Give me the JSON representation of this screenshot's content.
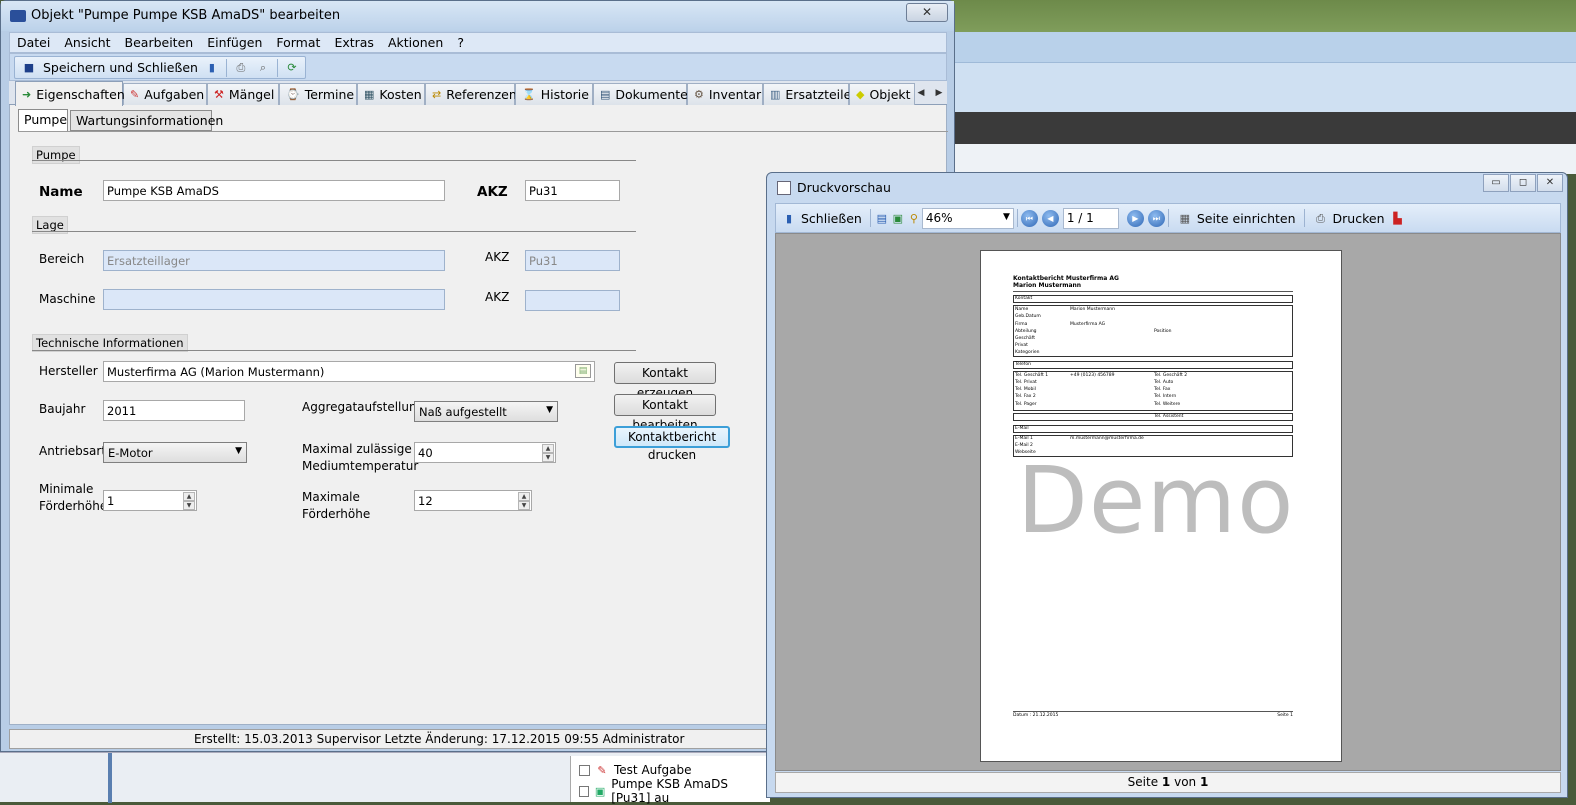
{
  "main_window": {
    "title": "Objekt \"Pumpe Pumpe KSB AmaDS\" bearbeiten",
    "close_glyph": "✕",
    "menu": [
      "Datei",
      "Ansicht",
      "Bearbeiten",
      "Einfügen",
      "Format",
      "Extras",
      "Aktionen",
      "?"
    ],
    "toolbar": {
      "save_close_label": "Speichern und Schließen"
    },
    "tabs": [
      {
        "label": "Eigenschaften",
        "icon": "eigenschaften-icon"
      },
      {
        "label": "Aufgaben",
        "icon": "aufgaben-icon"
      },
      {
        "label": "Mängel",
        "icon": "maengel-icon"
      },
      {
        "label": "Termine",
        "icon": "termine-icon"
      },
      {
        "label": "Kosten",
        "icon": "kosten-icon"
      },
      {
        "label": "Referenzen",
        "icon": "referenzen-icon"
      },
      {
        "label": "Historie",
        "icon": "historie-icon"
      },
      {
        "label": "Dokumente",
        "icon": "dokumente-icon"
      },
      {
        "label": "Inventar",
        "icon": "inventar-icon"
      },
      {
        "label": "Ersatzteile",
        "icon": "ersatzteile-icon"
      },
      {
        "label": "Objekt",
        "icon": "objekt-icon"
      }
    ],
    "subtabs": [
      "Pumpe",
      "Wartungsinformationen"
    ],
    "sections": {
      "pumpe": "Pumpe",
      "lage": "Lage",
      "technik": "Technische Informationen"
    },
    "form": {
      "name_label": "Name",
      "name_value": "Pumpe KSB AmaDS",
      "akz_label_big": "AKZ",
      "akz_value": "Pu31",
      "bereich_label": "Bereich",
      "bereich_value": "Ersatzteillager",
      "akz_label": "AKZ",
      "akz_bereich_value": "Pu31",
      "maschine_label": "Maschine",
      "maschine_value": "",
      "akz_maschine_value": "",
      "hersteller_label": "Hersteller",
      "hersteller_value": "Musterfirma AG  (Marion Mustermann)",
      "baujahr_label": "Baujahr",
      "baujahr_value": "2011",
      "aggregat_label": "Aggregataufstellung",
      "aggregat_value": "Naß aufgestellt",
      "antrieb_label": "Antriebsart",
      "antrieb_value": "E-Motor",
      "maxtemp_label_1": "Maximal zulässige",
      "maxtemp_label_2": "Mediumtemperatur",
      "maxtemp_value": "40",
      "minfh_label_1": "Minimale",
      "minfh_label_2": "Förderhöhe",
      "minfh_value": "1",
      "maxfh_label_1": "Maximale",
      "maxfh_label_2": "Förderhöhe",
      "maxfh_value": "12"
    },
    "buttons": {
      "kontakt_erzeugen": "Kontakt erzeugen",
      "kontakt_bearbeiten": "Kontakt bearbeiten",
      "kontaktbericht_drucken": "Kontaktbericht drucken"
    },
    "status": "Erstellt: 15.03.2013 Supervisor  Letzte Änderung: 17.12.2015 09:55 Administrator"
  },
  "background_list": [
    {
      "label": "Test Aufgabe"
    },
    {
      "label": "Pumpe KSB AmaDS [Pu31] au"
    }
  ],
  "preview_window": {
    "title": "Druckvorschau",
    "window_buttons": [
      "▭",
      "◻",
      "✕"
    ],
    "toolbar": {
      "close_label": "Schließen",
      "zoom": "46%",
      "page": "1 / 1",
      "setup_label": "Seite einrichten",
      "print_label": "Drucken"
    },
    "page_preview": {
      "heading_1": "Kontaktbericht Musterfirma AG",
      "heading_2": "Marion Mustermann",
      "section_kontakt": "Kontakt",
      "kontakt_rows": [
        {
          "k": "Name",
          "v": "Marion Mustermann"
        },
        {
          "k": "Geb.Datum",
          "v": ""
        },
        {
          "k": "Firma",
          "v": "Musterfirma AG"
        },
        {
          "k": "Abteilung",
          "v": ""
        },
        {
          "k": "Geschäft",
          "v": ""
        },
        {
          "k": "Privat",
          "v": ""
        },
        {
          "k": "Kategorien",
          "v": ""
        }
      ],
      "position_label": "Position",
      "section_telefon": "Telefon",
      "telefon_rows": [
        {
          "k": "Tel. Geschäft 1",
          "v": "+49 (0123) 456789",
          "k2": "Tel. Geschäft 2"
        },
        {
          "k": "Tel. Privat",
          "v": "",
          "k2": "Tel. Auto"
        },
        {
          "k": "Tel. Mobil",
          "v": "",
          "k2": "Tel. Fax"
        },
        {
          "k": "Tel. Fax 2",
          "v": "",
          "k2": "Tel. Intern"
        },
        {
          "k": "Tel. Pager",
          "v": "",
          "k2": "Tel. Weitere"
        }
      ],
      "assistent_label": "Tel. Assistent",
      "section_email": "E-Mail",
      "email_rows": [
        {
          "k": "E-Mail 1",
          "v": "m.mustermann@musterfirma.de"
        },
        {
          "k": "E-Mail 2",
          "v": ""
        },
        {
          "k": "Webseite",
          "v": ""
        }
      ],
      "watermark": "Demo",
      "footer_left": "Datum : 21.12.2015",
      "footer_right": "Seite 1"
    },
    "status_prefix": "Seite ",
    "status_page": "1",
    "status_mid": " von ",
    "status_total": "1"
  },
  "colors": {
    "window_frame": "#b8cde6",
    "focus_button": "#3c9fd8",
    "disabled_field": "#dbe7f8"
  }
}
